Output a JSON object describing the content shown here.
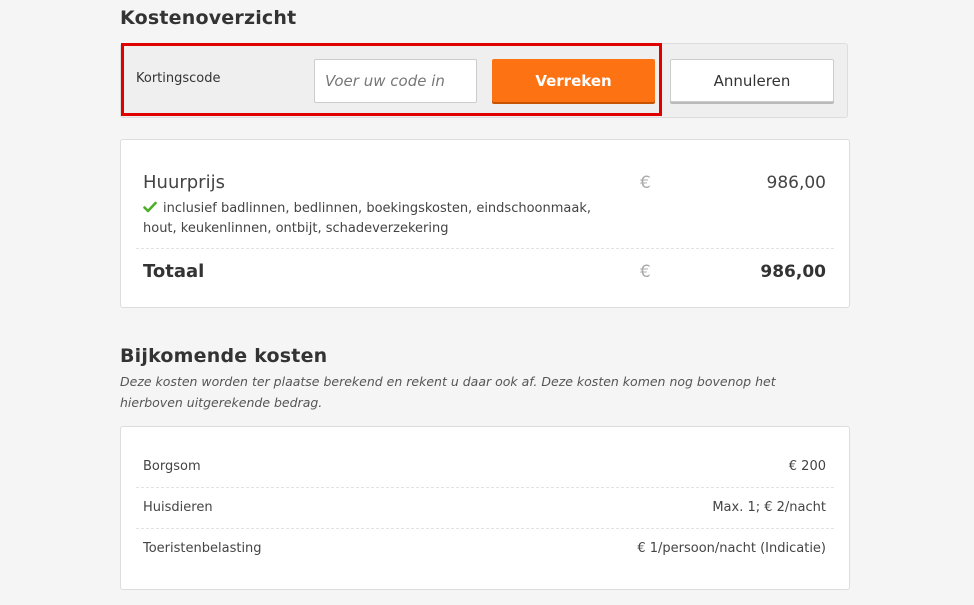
{
  "section_title": "Kostenoverzicht",
  "discount": {
    "label": "Kortingscode",
    "placeholder": "Voer uw code in",
    "apply_label": "Verreken",
    "cancel_label": "Annuleren"
  },
  "costs": {
    "rent_label": "Huurprijs",
    "rent_currency": "€",
    "rent_amount": "986,00",
    "included_text": "inclusief badlinnen, bedlinnen, boekingskosten, eindschoonmaak, hout, keukenlinnen, ontbijt, schadeverzekering",
    "total_label": "Totaal",
    "total_currency": "€",
    "total_amount": "986,00"
  },
  "additional": {
    "title": "Bijkomende kosten",
    "note": "Deze kosten worden ter plaatse berekend en rekent u daar ook af. Deze kosten komen nog bovenop het hierboven uitgerekende bedrag.",
    "rows": [
      {
        "label": "Borgsom",
        "value": "€ 200"
      },
      {
        "label": "Huisdieren",
        "value": "Max. 1; € 2/nacht"
      },
      {
        "label": "Toeristenbelasting",
        "value": "€ 1/persoon/nacht (Indicatie)"
      }
    ]
  },
  "colors": {
    "primary_button": "#fd7314",
    "highlight_border": "#e00000",
    "check_green": "#4caf2a"
  }
}
